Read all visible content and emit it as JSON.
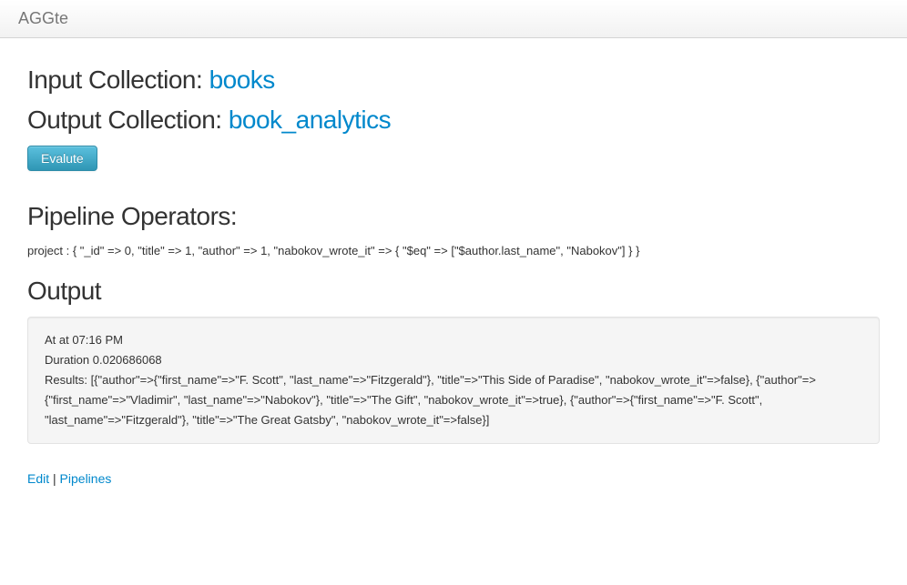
{
  "navbar": {
    "brand": "AGGte"
  },
  "headings": {
    "input_label": "Input Collection: ",
    "input_value": "books",
    "output_label": "Output Collection: ",
    "output_value": "book_analytics",
    "pipeline_operators": "Pipeline Operators:",
    "output": "Output"
  },
  "buttons": {
    "evaluate": "Evalute"
  },
  "pipeline": {
    "text": "project : { \"_id\" => 0, \"title\" => 1, \"author\" => 1, \"nabokov_wrote_it\" => { \"$eq\" => [\"$author.last_name\", \"Nabokov\"] } }"
  },
  "output_panel": {
    "timestamp": "At at 07:16 PM",
    "duration": "Duration 0.020686068",
    "results": "Results: [{\"author\"=>{\"first_name\"=>\"F. Scott\", \"last_name\"=>\"Fitzgerald\"}, \"title\"=>\"This Side of Paradise\", \"nabokov_wrote_it\"=>false}, {\"author\"=>{\"first_name\"=>\"Vladimir\", \"last_name\"=>\"Nabokov\"}, \"title\"=>\"The Gift\", \"nabokov_wrote_it\"=>true}, {\"author\"=>{\"first_name\"=>\"F. Scott\", \"last_name\"=>\"Fitzgerald\"}, \"title\"=>\"The Great Gatsby\", \"nabokov_wrote_it\"=>false}]"
  },
  "links": {
    "edit": "Edit",
    "separator": " | ",
    "pipelines": "Pipelines"
  }
}
